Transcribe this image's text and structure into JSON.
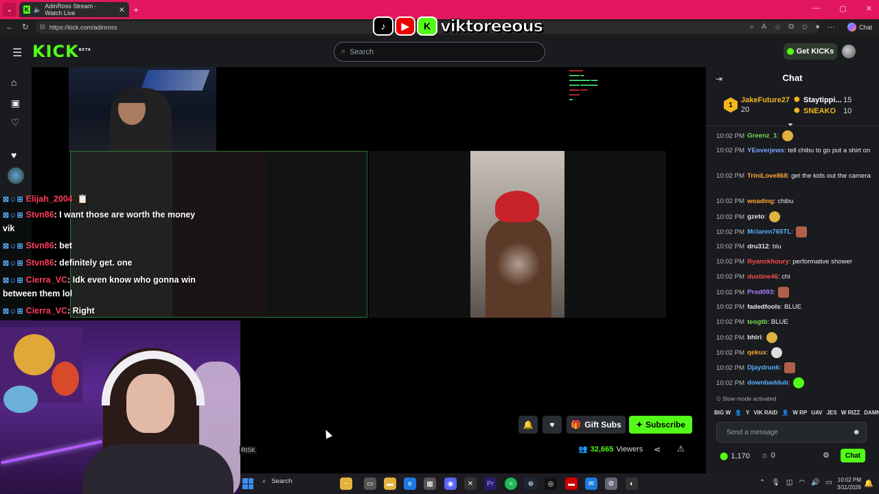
{
  "browser": {
    "tab_title": "AdinRoss Stream - Watch Live",
    "url": "https://kick.com/adinross",
    "copilot_label": "Chat"
  },
  "overlay_brand": {
    "name": "viktoreeous"
  },
  "kick": {
    "logo": "KICK",
    "logo_beta": "BETA",
    "search_placeholder": "Search",
    "get_kicks_label": "Get KICKs"
  },
  "overlay_chat": [
    {
      "user": "Elijah_2004",
      "message": "  📋"
    },
    {
      "user": "Stvn86",
      "message": ": I want those are worth the money"
    },
    {
      "user": "",
      "message": "vik"
    },
    {
      "user": "Stvn86",
      "message": ": bet"
    },
    {
      "user": "Stvn86",
      "message": ": definitely get. one"
    },
    {
      "user": "Cierra_VC",
      "message": ": Idk even know who gonna win"
    },
    {
      "user": "",
      "message": "between them lol"
    },
    {
      "user": "Cierra_VC",
      "message": ": Right"
    }
  ],
  "player": {
    "gift_subs_label": "Gift Subs",
    "subscribe_label": "Subscribe",
    "viewers_count": "32,665",
    "viewers_label": "Viewers",
    "risk_tag": "RISK"
  },
  "chat": {
    "title": "Chat",
    "pinned": {
      "first_user": "JakeFuture27",
      "first_count": "20",
      "first_rank": "1",
      "second_user": "Staytippi...",
      "second_count": "15",
      "third_user": "SNEAKO",
      "third_count": "10"
    },
    "messages": [
      {
        "time": "10:02 PM",
        "user": "Greenz_1",
        "color": "#7cd957",
        "text": "",
        "emote": "#e0b040"
      },
      {
        "time": "10:02 PM",
        "user": "YEoverjews",
        "color": "#7fa8ff",
        "text": "tell chibu to go put a shirt on",
        "emote": ""
      },
      {
        "time": "10:02 PM",
        "user": "TriniLove868",
        "color": "#ffa63a",
        "text": "get the kids out the camera",
        "emote": ""
      },
      {
        "time": "10:02 PM",
        "user": "woading",
        "color": "#ffa63a",
        "text": "chibu",
        "emote": ""
      },
      {
        "time": "10:02 PM",
        "user": "gzeto",
        "color": "#e6e6e6",
        "text": "",
        "emote": "#e0b040"
      },
      {
        "time": "10:02 PM",
        "user": "Mclaren765TL",
        "color": "#5ab0ff",
        "text": "",
        "emote": "#b0604a"
      },
      {
        "time": "10:02 PM",
        "user": "dru312",
        "color": "#e6e6e6",
        "text": "blu",
        "emote": ""
      },
      {
        "time": "10:02 PM",
        "user": "Ryanckhoury",
        "color": "#ff4a4a",
        "text": "performative shower",
        "emote": ""
      },
      {
        "time": "10:02 PM",
        "user": "dustine46",
        "color": "#ff4a4a",
        "text": "chi",
        "emote": ""
      },
      {
        "time": "10:02 PM",
        "user": "Prod093",
        "color": "#b07cff",
        "text": "",
        "emote": "#b0604a"
      },
      {
        "time": "10:02 PM",
        "user": "fadedfools",
        "color": "#e6e6e6",
        "text": "BLUE",
        "emote": ""
      },
      {
        "time": "10:02 PM",
        "user": "teogtb",
        "color": "#7cd957",
        "text": "BLUE",
        "emote": ""
      },
      {
        "time": "10:02 PM",
        "user": "bhiri",
        "color": "#e6e6e6",
        "text": "",
        "emote": "#e0b040"
      },
      {
        "time": "10:02 PM",
        "user": "qekux",
        "color": "#ffa63a",
        "text": "",
        "emote": "#dddddd"
      },
      {
        "time": "10:02 PM",
        "user": "Djaydrunk",
        "color": "#5ab0ff",
        "text": "",
        "emote": "#b0604a"
      },
      {
        "time": "10:02 PM",
        "user": "downbaddub",
        "color": "#5ab0ff",
        "text": "",
        "emote": "#53fc18"
      }
    ],
    "slow_mode": "Slow mode activated",
    "emotes": [
      "BIG W",
      "👤",
      "Y",
      "VIK RAID",
      "👤",
      "W RP",
      "UAV",
      "JES",
      "W RIZZ",
      "DAMN"
    ],
    "input_placeholder": "Send a message",
    "kicks_balance": "1,170",
    "gift_balance": "0",
    "send_label": "Chat"
  },
  "taskbar": {
    "search_label": "Search",
    "time": "10:02 PM",
    "date": "3/11/2026"
  },
  "colors": {
    "kick_green": "#53fc18",
    "tab_bar": "#e3175f",
    "panel_bg": "#191b1f"
  }
}
